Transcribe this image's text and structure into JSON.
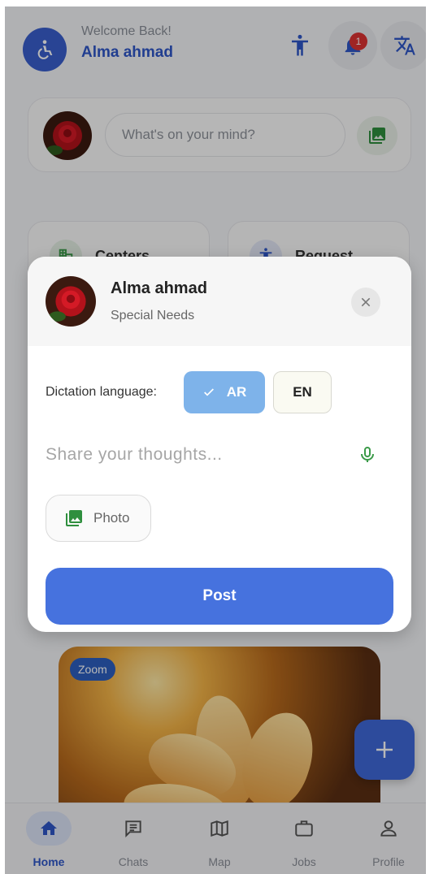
{
  "header": {
    "welcome_text": "Welcome Back!",
    "user_name": "Alma ahmad",
    "notification_count": "1"
  },
  "composer": {
    "placeholder": "What's on your mind?"
  },
  "quick_actions": [
    {
      "label": "Centers"
    },
    {
      "label": "Request"
    }
  ],
  "feed": {
    "zoom_label": "Zoom"
  },
  "modal": {
    "user_name": "Alma ahmad",
    "user_subtitle": "Special Needs",
    "dictation_label": "Dictation language:",
    "lang_ar": "AR",
    "lang_en": "EN",
    "selected_language": "AR",
    "thoughts_placeholder": "Share your thoughts...",
    "photo_label": "Photo",
    "post_label": "Post"
  },
  "nav": [
    {
      "label": "Home",
      "active": true
    },
    {
      "label": "Chats",
      "active": false
    },
    {
      "label": "Map",
      "active": false
    },
    {
      "label": "Jobs",
      "active": false
    },
    {
      "label": "Profile",
      "active": false
    }
  ],
  "colors": {
    "primary": "#4672de",
    "brand_blue": "#2f56c8",
    "lang_selected": "#7eb3ea",
    "icon_green": "#3a9a48",
    "badge_red": "#d33333"
  }
}
